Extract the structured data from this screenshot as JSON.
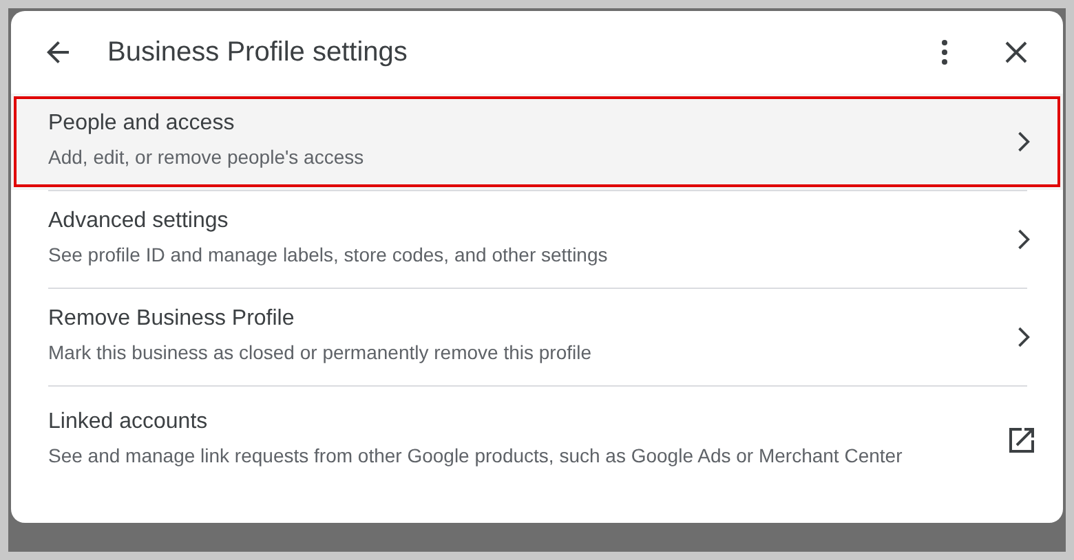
{
  "dialog": {
    "title": "Business Profile settings"
  },
  "items": [
    {
      "title": "People and access",
      "subtitle": "Add, edit, or remove people's access",
      "kind": "chevron",
      "selected": true
    },
    {
      "title": "Advanced settings",
      "subtitle": "See profile ID and manage labels, store codes, and other settings",
      "kind": "chevron",
      "selected": false
    },
    {
      "title": "Remove Business Profile",
      "subtitle": "Mark this business as closed or permanently remove this profile",
      "kind": "chevron",
      "selected": false
    },
    {
      "title": "Linked accounts",
      "subtitle": "See and manage link requests from other Google products, such as Google Ads or Merchant Center",
      "kind": "external",
      "selected": false
    }
  ]
}
